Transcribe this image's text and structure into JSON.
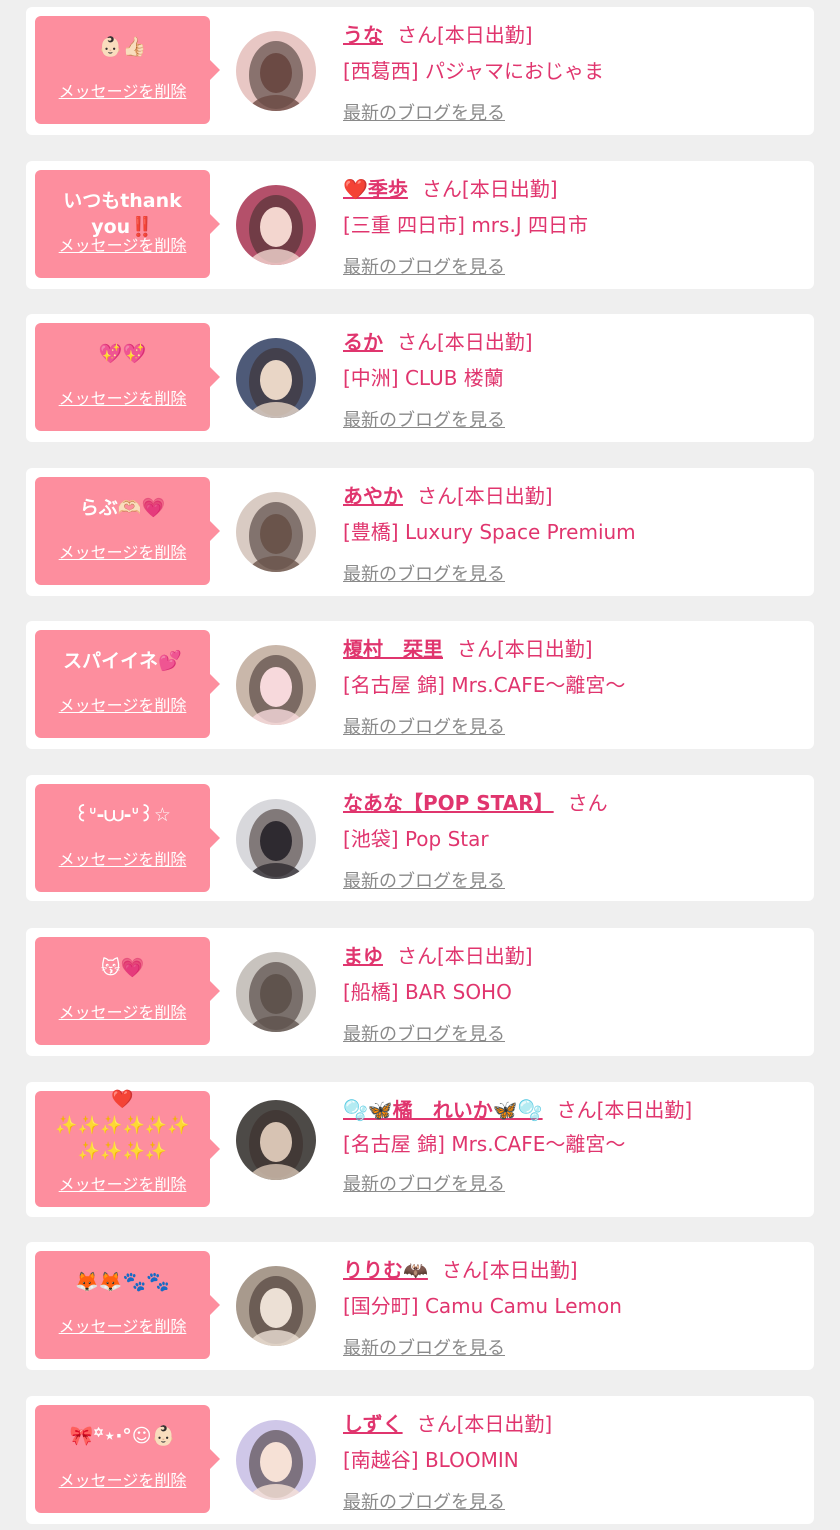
{
  "delete_label": "メッセージを削除",
  "blog_label": "最新のブログを見る",
  "san_label": "さん",
  "colors": {
    "bubble": "#fd8e9e",
    "name": "#e0356e",
    "link_gray": "#8a8a8a",
    "background": "#efefef"
  },
  "cards": [
    {
      "message": "👶🏻👍🏻",
      "name": "うな",
      "status": "[本日出勤]",
      "shop": "[西葛西] パジャマにおじゃま",
      "avatar": {
        "bg": "#e8c7c4",
        "fg": "#6b4a44"
      }
    },
    {
      "message": "いつもthank you‼️",
      "name": "❤️季歩",
      "status": "[本日出勤]",
      "shop": "[三重 四日市] mrs.J 四日市",
      "avatar": {
        "bg": "#b4506a",
        "fg": "#f3d6cf"
      }
    },
    {
      "message": "💖💖",
      "name": "るか",
      "status": "[本日出勤]",
      "shop": "[中洲] CLUB 楼蘭",
      "avatar": {
        "bg": "#4e5a78",
        "fg": "#e9d6c6"
      }
    },
    {
      "message": "らぶ🫶🏻💗",
      "name": "あやか",
      "status": "[本日出勤]",
      "shop": "[豊橋] Luxury Space Premium",
      "avatar": {
        "bg": "#d9cbc3",
        "fg": "#6a544b"
      }
    },
    {
      "message": "スパイイネ💕",
      "name": "榎村　栞里",
      "status": "[本日出勤]",
      "shop": "[名古屋 錦] Mrs.CAFE〜離宮〜",
      "avatar": {
        "bg": "#c9b7aa",
        "fg": "#f7d9dc"
      }
    },
    {
      "message": "꒰ᐡ-⩊-ᐡ꒱☆",
      "name": "なあな【POP STAR】",
      "status": "",
      "shop": "[池袋] Pop Star",
      "avatar": {
        "bg": "#d8d8dc",
        "fg": "#2e2a30"
      }
    },
    {
      "message": "😽💗",
      "name": "まゆ",
      "status": "[本日出勤]",
      "shop": "[船橋] BAR SOHO",
      "avatar": {
        "bg": "#c8c3be",
        "fg": "#5f534d"
      }
    },
    {
      "message": "❤️\n✨✨✨✨✨✨\n✨✨✨✨",
      "name": "🫧🦋橘　れいか🦋🫧",
      "status": "[本日出勤]",
      "shop": "[名古屋 錦] Mrs.CAFE〜離宮〜",
      "avatar": {
        "bg": "#4d4a47",
        "fg": "#d7c3b3"
      },
      "tall": true
    },
    {
      "message": "🦊🦊🐾🐾",
      "name": "りりむ🦇",
      "status": "[本日出勤]",
      "shop": "[国分町] Camu Camu Lemon",
      "avatar": {
        "bg": "#a89a8d",
        "fg": "#ece0d5"
      }
    },
    {
      "message": "🎀꙳⋆‧°☺︎👶🏻",
      "name": "しずく",
      "status": "[本日出勤]",
      "shop": "[南越谷] BLOOMIN",
      "avatar": {
        "bg": "#cfc7e8",
        "fg": "#f6e1d6"
      }
    }
  ]
}
